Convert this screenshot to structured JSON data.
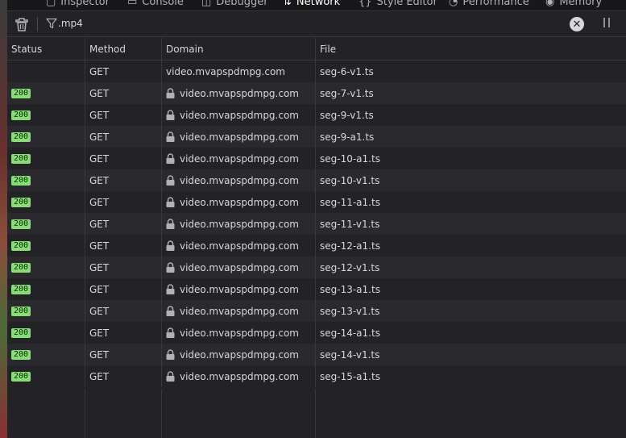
{
  "tabs": [
    {
      "label": "Inspector",
      "icon": "inspector-icon"
    },
    {
      "label": "Console",
      "icon": "console-icon"
    },
    {
      "label": "Debugger",
      "icon": "debugger-icon"
    },
    {
      "label": "Network",
      "icon": "network-icon",
      "active": true
    },
    {
      "label": "Style Editor",
      "icon": "style-editor-icon"
    },
    {
      "label": "Performance",
      "icon": "performance-icon"
    },
    {
      "label": "Memory",
      "icon": "memory-icon"
    }
  ],
  "toolbar": {
    "filter_value": ".mp4"
  },
  "table": {
    "columns": [
      "Status",
      "Method",
      "Domain",
      "File"
    ],
    "rows": [
      {
        "status": "",
        "method": "GET",
        "domain": "video.mvapspdmpg.com",
        "secure": false,
        "file": "seg-6-v1.ts"
      },
      {
        "status": "200",
        "method": "GET",
        "domain": "video.mvapspdmpg.com",
        "secure": true,
        "file": "seg-7-v1.ts"
      },
      {
        "status": "200",
        "method": "GET",
        "domain": "video.mvapspdmpg.com",
        "secure": true,
        "file": "seg-9-v1.ts"
      },
      {
        "status": "200",
        "method": "GET",
        "domain": "video.mvapspdmpg.com",
        "secure": true,
        "file": "seg-9-a1.ts"
      },
      {
        "status": "200",
        "method": "GET",
        "domain": "video.mvapspdmpg.com",
        "secure": true,
        "file": "seg-10-a1.ts"
      },
      {
        "status": "200",
        "method": "GET",
        "domain": "video.mvapspdmpg.com",
        "secure": true,
        "file": "seg-10-v1.ts"
      },
      {
        "status": "200",
        "method": "GET",
        "domain": "video.mvapspdmpg.com",
        "secure": true,
        "file": "seg-11-a1.ts"
      },
      {
        "status": "200",
        "method": "GET",
        "domain": "video.mvapspdmpg.com",
        "secure": true,
        "file": "seg-11-v1.ts"
      },
      {
        "status": "200",
        "method": "GET",
        "domain": "video.mvapspdmpg.com",
        "secure": true,
        "file": "seg-12-a1.ts"
      },
      {
        "status": "200",
        "method": "GET",
        "domain": "video.mvapspdmpg.com",
        "secure": true,
        "file": "seg-12-v1.ts"
      },
      {
        "status": "200",
        "method": "GET",
        "domain": "video.mvapspdmpg.com",
        "secure": true,
        "file": "seg-13-a1.ts"
      },
      {
        "status": "200",
        "method": "GET",
        "domain": "video.mvapspdmpg.com",
        "secure": true,
        "file": "seg-13-v1.ts"
      },
      {
        "status": "200",
        "method": "GET",
        "domain": "video.mvapspdmpg.com",
        "secure": true,
        "file": "seg-14-a1.ts"
      },
      {
        "status": "200",
        "method": "GET",
        "domain": "video.mvapspdmpg.com",
        "secure": true,
        "file": "seg-14-v1.ts"
      },
      {
        "status": "200",
        "method": "GET",
        "domain": "video.mvapspdmpg.com",
        "secure": true,
        "file": "seg-15-a1.ts"
      }
    ]
  },
  "colors": {
    "background": "#232327",
    "status_ok": "#86de74"
  }
}
